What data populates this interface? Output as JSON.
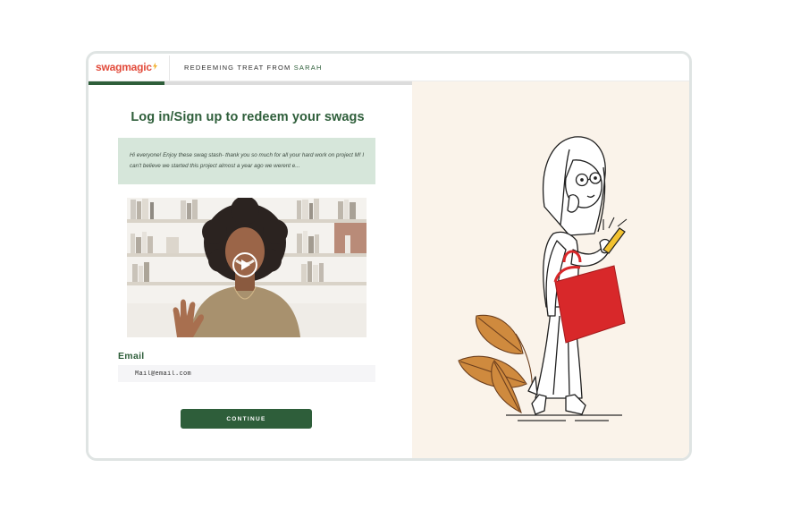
{
  "brand": {
    "logo_text": "swagmagic",
    "accent_color": "#e24b3b",
    "primary_color": "#2e5e3a"
  },
  "header": {
    "redeem_prefix": "REDEEMING TREAT FROM",
    "sender_name": "SARAH",
    "progress_fraction": 0.235
  },
  "main": {
    "title": "Log in/Sign up to redeem your swags",
    "message": "Hi everyone! Enjoy these swag stash- thank you so much for all your hard work on project M! I can't believe we started this project almost a year ago we werent e...",
    "video": {
      "play_icon": "play-icon"
    },
    "email_label": "Email",
    "email_placeholder": "Mail@email.com",
    "continue_label": "CONTINUE"
  },
  "illustration": {
    "subject": "woman-with-red-bag-and-phone",
    "bag_color": "#d8282a",
    "leaf_color": "#cf8a3e",
    "phone_color": "#f2c230",
    "panel_color": "#faf3ea"
  }
}
